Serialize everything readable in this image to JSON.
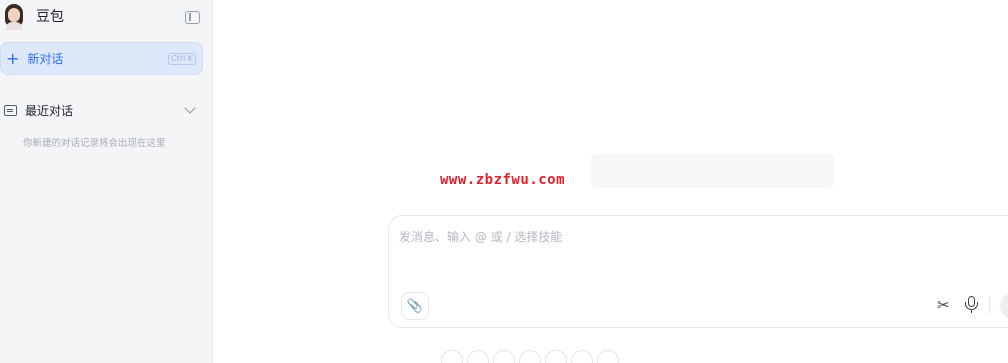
{
  "sidebar": {
    "brand_name": "豆包",
    "new_chat": {
      "label": "新对话",
      "shortcut": "Ctrl K"
    },
    "recent": {
      "label": "最近对话",
      "empty_hint": "你新建的对话记录将会出现在这里"
    }
  },
  "watermark": "www.zbzfwu.com",
  "composer": {
    "placeholder": "发消息、输入 @ 或 / 选择技能",
    "value": ""
  },
  "icons": {
    "avatar": "avatar",
    "collapse": "sidebar-collapse-icon",
    "plus": "plus-icon",
    "chat": "chat-bubble-icon",
    "chevron": "chevron-down-icon",
    "attach": "paperclip-icon",
    "scissors": "scissors-icon",
    "mic": "microphone-icon"
  },
  "colors": {
    "accent": "#2f6bff",
    "sidebar_bg": "#f4f5f7",
    "watermark": "#e0202a"
  }
}
